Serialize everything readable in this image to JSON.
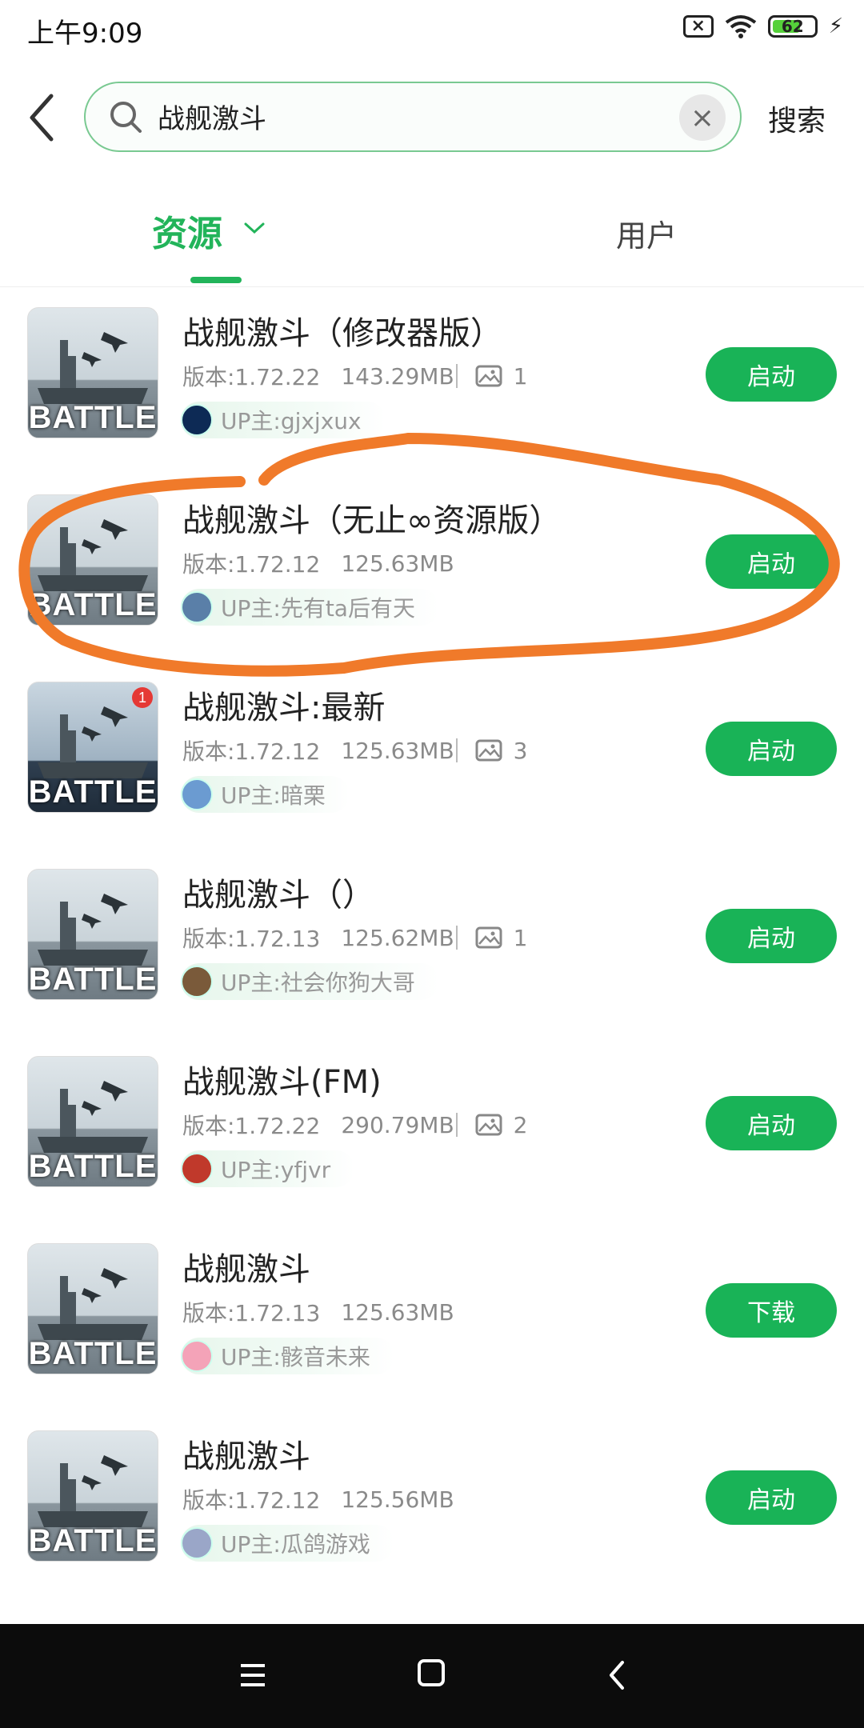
{
  "status_bar": {
    "time": "上午9:09",
    "battery": "62",
    "icons": [
      "sim-off-icon",
      "wifi-icon",
      "battery-icon",
      "charging-icon"
    ]
  },
  "search": {
    "query": "战舰激斗",
    "clear_icon": "clear-icon",
    "button_label": "搜索"
  },
  "tabs": {
    "active": "资源",
    "inactive": "用户"
  },
  "colors": {
    "accent": "#19b357",
    "annotation": "#f07a2a",
    "nav_bar": "#0c0c0c"
  },
  "items": [
    {
      "title": "战舰激斗（修改器版）",
      "version": "版本:1.72.22",
      "size": "143.29MB",
      "images": "1",
      "uploader": "UP主:gjxjxux",
      "button": "启动",
      "thumb_word": "BATTLE"
    },
    {
      "title": "战舰激斗（无止∞资源版）",
      "version": "版本:1.72.12",
      "size": "125.63MB",
      "images": null,
      "uploader": "UP主:先有ta后有天",
      "button": "启动",
      "thumb_word": "BATTLE"
    },
    {
      "title": "战舰激斗:最新",
      "version": "版本:1.72.12",
      "size": "125.63MB",
      "images": "3",
      "uploader": "UP主:暗栗",
      "button": "启动",
      "thumb_word": "BATTLE",
      "thumb_badge": "1"
    },
    {
      "title": "战舰激斗（）",
      "version": "版本:1.72.13",
      "size": "125.62MB",
      "images": "1",
      "uploader": "UP主:社会你狗大哥",
      "button": "启动",
      "thumb_word": "BATTLE"
    },
    {
      "title": "战舰激斗(FM)",
      "version": "版本:1.72.22",
      "size": "290.79MB",
      "images": "2",
      "uploader": "UP主:yfjvr",
      "button": "启动",
      "thumb_word": "BATTLE"
    },
    {
      "title": "战舰激斗",
      "version": "版本:1.72.13",
      "size": "125.63MB",
      "images": null,
      "uploader": "UP主:骸音未来",
      "button": "下载",
      "thumb_word": "BATTLE"
    },
    {
      "title": "战舰激斗",
      "version": "版本:1.72.12",
      "size": "125.56MB",
      "images": null,
      "uploader": "UP主:瓜鸽游戏",
      "button": "启动",
      "thumb_word": "BATTLE"
    }
  ],
  "nav_bar": {
    "icons": [
      "menu-icon",
      "home-icon",
      "back-icon"
    ]
  }
}
